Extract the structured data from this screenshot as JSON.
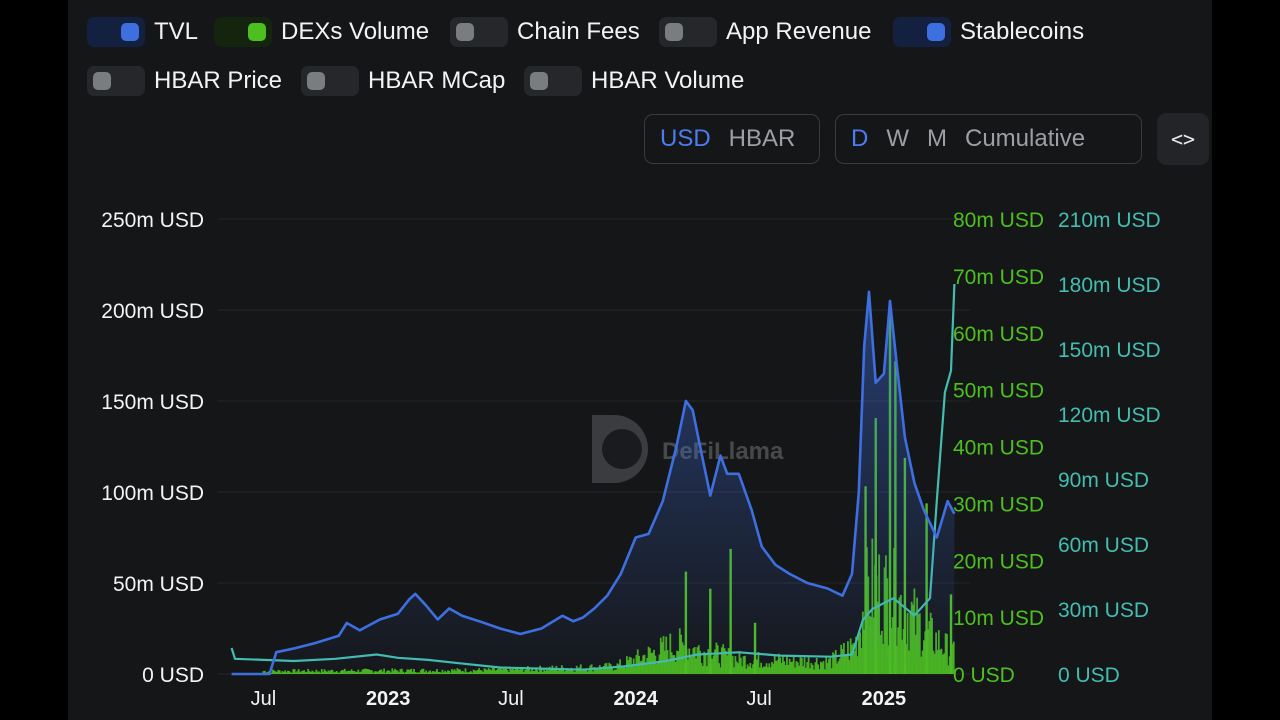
{
  "legend": [
    {
      "key": "tvl",
      "label": "TVL",
      "on": true,
      "color": "#3e6fe0"
    },
    {
      "key": "dexs",
      "label": "DEXs Volume",
      "on": true,
      "color": "#4dbf1f"
    },
    {
      "key": "fees",
      "label": "Chain Fees",
      "on": false
    },
    {
      "key": "revenue",
      "label": "App Revenue",
      "on": false
    },
    {
      "key": "stable",
      "label": "Stablecoins",
      "on": true,
      "color": "#3e6fe0"
    },
    {
      "key": "price",
      "label": "HBAR Price",
      "on": false
    },
    {
      "key": "mcap",
      "label": "HBAR MCap",
      "on": false
    },
    {
      "key": "volume",
      "label": "HBAR Volume",
      "on": false
    }
  ],
  "denomination": {
    "options": [
      "USD",
      "HBAR"
    ],
    "active": "USD"
  },
  "period": {
    "options": [
      "D",
      "W",
      "M",
      "Cumulative"
    ],
    "active": "D"
  },
  "embed_icon": "code-icon",
  "watermark": {
    "text": "DeFiLlama"
  },
  "colors": {
    "tvl": "#3e6fe0",
    "dexs": "#4dbf1f",
    "stable": "#43bdb0",
    "axis_left": "#f2f3f5",
    "axis_dex": "#4dbf1f",
    "axis_stable": "#43bdb0"
  },
  "chart_data": {
    "type": "line",
    "x_ticks": [
      {
        "label": "Jul",
        "date": "2022-07-01",
        "bold": false
      },
      {
        "label": "2023",
        "date": "2023-01-01",
        "bold": true
      },
      {
        "label": "Jul",
        "date": "2023-07-01",
        "bold": false
      },
      {
        "label": "2024",
        "date": "2024-01-01",
        "bold": true
      },
      {
        "label": "Jul",
        "date": "2024-07-01",
        "bold": false
      },
      {
        "label": "2025",
        "date": "2025-01-01",
        "bold": true
      }
    ],
    "y_axes": [
      {
        "id": "tvl",
        "side": "left",
        "min": 0,
        "max": 250000000,
        "ticks": [
          "0 USD",
          "50m USD",
          "100m USD",
          "150m USD",
          "200m USD",
          "250m USD"
        ]
      },
      {
        "id": "dexs",
        "side": "right",
        "min": 0,
        "max": 80000000,
        "ticks": [
          "0 USD",
          "10m USD",
          "20m USD",
          "30m USD",
          "40m USD",
          "50m USD",
          "60m USD",
          "70m USD",
          "80m USD"
        ]
      },
      {
        "id": "stable",
        "side": "right",
        "min": 0,
        "max": 210000000,
        "ticks": [
          "0 USD",
          "30m USD",
          "60m USD",
          "90m USD",
          "120m USD",
          "150m USD",
          "180m USD",
          "210m USD"
        ]
      }
    ],
    "series": [
      {
        "name": "TVL",
        "axis": "tvl",
        "style": "area",
        "points": [
          [
            "2022-05-15",
            0
          ],
          [
            "2022-07-10",
            0
          ],
          [
            "2022-07-20",
            12000000
          ],
          [
            "2022-08-15",
            14000000
          ],
          [
            "2022-09-15",
            17000000
          ],
          [
            "2022-10-20",
            21000000
          ],
          [
            "2022-11-01",
            28000000
          ],
          [
            "2022-11-20",
            24000000
          ],
          [
            "2022-12-20",
            30000000
          ],
          [
            "2023-01-15",
            33000000
          ],
          [
            "2023-02-01",
            41000000
          ],
          [
            "2023-02-10",
            44000000
          ],
          [
            "2023-02-25",
            38000000
          ],
          [
            "2023-03-15",
            30000000
          ],
          [
            "2023-04-01",
            36000000
          ],
          [
            "2023-04-20",
            32000000
          ],
          [
            "2023-05-15",
            29000000
          ],
          [
            "2023-06-15",
            25000000
          ],
          [
            "2023-07-15",
            22000000
          ],
          [
            "2023-08-15",
            25000000
          ],
          [
            "2023-09-15",
            32000000
          ],
          [
            "2023-10-01",
            29000000
          ],
          [
            "2023-10-15",
            31000000
          ],
          [
            "2023-11-01",
            36000000
          ],
          [
            "2023-11-20",
            43000000
          ],
          [
            "2023-12-10",
            55000000
          ],
          [
            "2024-01-01",
            75000000
          ],
          [
            "2024-01-20",
            77000000
          ],
          [
            "2024-02-10",
            95000000
          ],
          [
            "2024-03-01",
            125000000
          ],
          [
            "2024-03-15",
            150000000
          ],
          [
            "2024-03-25",
            145000000
          ],
          [
            "2024-04-05",
            125000000
          ],
          [
            "2024-04-20",
            98000000
          ],
          [
            "2024-05-05",
            120000000
          ],
          [
            "2024-05-15",
            110000000
          ],
          [
            "2024-06-01",
            110000000
          ],
          [
            "2024-06-20",
            90000000
          ],
          [
            "2024-07-05",
            70000000
          ],
          [
            "2024-07-25",
            60000000
          ],
          [
            "2024-08-15",
            55000000
          ],
          [
            "2024-09-10",
            50000000
          ],
          [
            "2024-10-10",
            47000000
          ],
          [
            "2024-11-01",
            43000000
          ],
          [
            "2024-11-15",
            55000000
          ],
          [
            "2024-11-25",
            100000000
          ],
          [
            "2024-12-03",
            180000000
          ],
          [
            "2024-12-10",
            210000000
          ],
          [
            "2024-12-20",
            160000000
          ],
          [
            "2025-01-01",
            165000000
          ],
          [
            "2025-01-10",
            205000000
          ],
          [
            "2025-01-20",
            170000000
          ],
          [
            "2025-02-01",
            130000000
          ],
          [
            "2025-02-15",
            105000000
          ],
          [
            "2025-03-01",
            90000000
          ],
          [
            "2025-03-20",
            75000000
          ],
          [
            "2025-04-05",
            95000000
          ],
          [
            "2025-04-15",
            88000000
          ]
        ]
      },
      {
        "name": "Stablecoins",
        "axis": "stable",
        "style": "line",
        "points": [
          [
            "2022-05-15",
            12000000
          ],
          [
            "2022-05-20",
            7000000
          ],
          [
            "2022-08-15",
            6000000
          ],
          [
            "2022-10-15",
            7000000
          ],
          [
            "2022-12-15",
            9000000
          ],
          [
            "2023-01-15",
            7500000
          ],
          [
            "2023-03-01",
            6500000
          ],
          [
            "2023-04-15",
            5000000
          ],
          [
            "2023-06-15",
            3000000
          ],
          [
            "2023-08-15",
            2500000
          ],
          [
            "2023-10-15",
            2000000
          ],
          [
            "2023-12-15",
            3500000
          ],
          [
            "2024-02-15",
            6000000
          ],
          [
            "2024-04-01",
            9000000
          ],
          [
            "2024-06-01",
            10000000
          ],
          [
            "2024-08-01",
            8500000
          ],
          [
            "2024-10-15",
            8000000
          ],
          [
            "2024-11-15",
            9000000
          ],
          [
            "2024-12-01",
            25000000
          ],
          [
            "2024-12-15",
            30000000
          ],
          [
            "2025-01-15",
            35000000
          ],
          [
            "2025-02-15",
            27000000
          ],
          [
            "2025-03-10",
            35000000
          ],
          [
            "2025-03-20",
            80000000
          ],
          [
            "2025-04-01",
            130000000
          ],
          [
            "2025-04-10",
            140000000
          ],
          [
            "2025-04-15",
            180000000
          ]
        ]
      },
      {
        "name": "DEXs Volume",
        "axis": "dexs",
        "style": "bar",
        "spikes": [
          [
            "2024-03-15",
            18000000
          ],
          [
            "2024-04-20",
            15000000
          ],
          [
            "2024-05-20",
            22000000
          ],
          [
            "2024-06-25",
            9000000
          ],
          [
            "2024-12-05",
            33000000
          ],
          [
            "2024-12-20",
            45000000
          ],
          [
            "2025-01-10",
            63000000
          ],
          [
            "2025-01-18",
            55000000
          ],
          [
            "2025-02-01",
            38000000
          ],
          [
            "2025-03-05",
            30000000
          ],
          [
            "2025-04-10",
            14000000
          ]
        ]
      }
    ]
  }
}
